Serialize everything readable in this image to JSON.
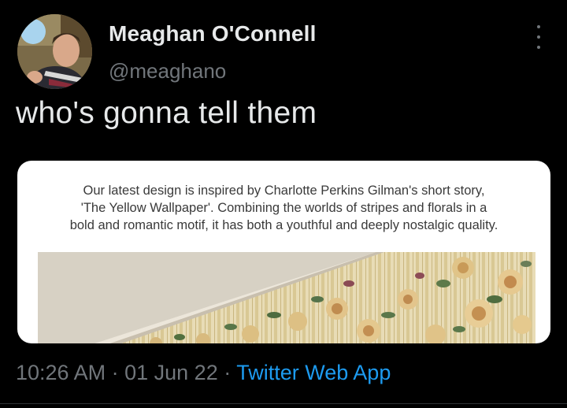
{
  "author": {
    "name": "Meaghan O'Connell",
    "handle": "@meaghano"
  },
  "tweet": {
    "text": "who's gonna tell them"
  },
  "media": {
    "caption_lines": [
      "Our latest design is inspired by Charlotte Perkins Gilman's short story,",
      "'The Yellow Wallpaper'. Combining the worlds of stripes and florals in a",
      "bold and romantic motif, it has both a youthful and deeply nostalgic quality."
    ]
  },
  "meta": {
    "time": "10:26 AM",
    "date": "01 Jun 22",
    "source": "Twitter Web App",
    "separator": "·"
  },
  "colors": {
    "background": "#000000",
    "primary_text": "#e7e9ea",
    "secondary_text": "#71767b",
    "link": "#1d9bf0"
  }
}
